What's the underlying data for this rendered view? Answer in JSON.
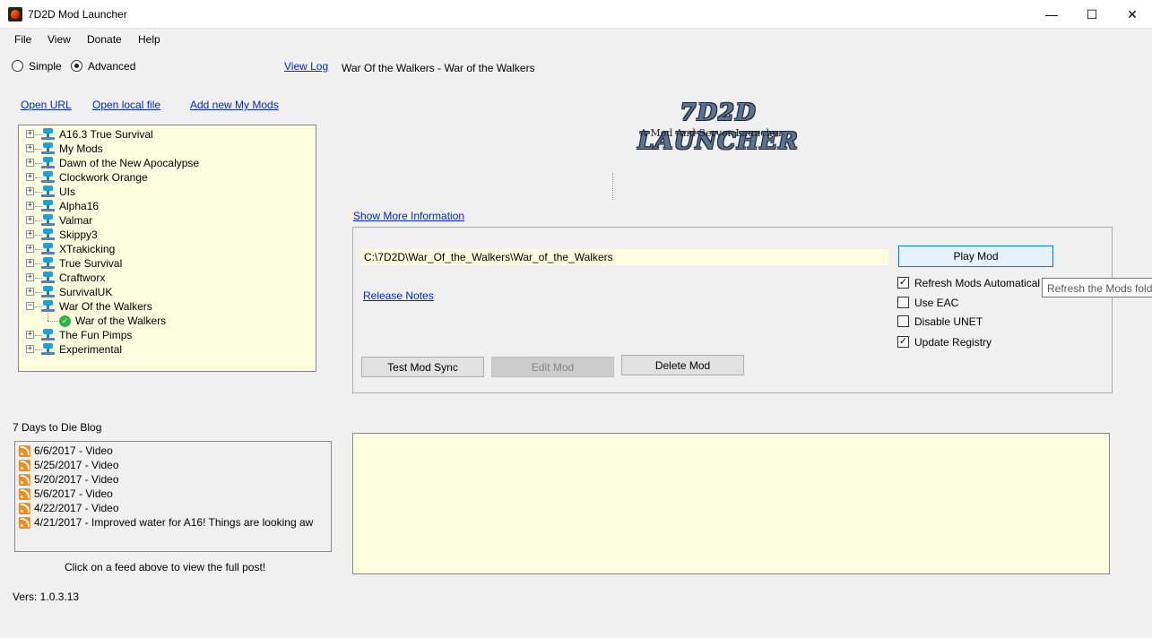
{
  "window": {
    "title": "7D2D Mod Launcher",
    "minimize": "—",
    "maximize": "☐",
    "close": "✕"
  },
  "menu": [
    "File",
    "View",
    "Donate",
    "Help"
  ],
  "mode": {
    "simple": "Simple",
    "advanced": "Advanced",
    "selected": "Advanced"
  },
  "view_log": "View Log",
  "current_mod_title": "War Of the Walkers - War of the Walkers",
  "links": {
    "open_url": "Open URL",
    "open_local_file": "Open local file",
    "add_new_my_mods": "Add new My Mods"
  },
  "tree": {
    "items": [
      {
        "label": "A16.3 True Survival",
        "expanded": false
      },
      {
        "label": "My Mods",
        "expanded": false
      },
      {
        "label": "Dawn of the New Apocalypse",
        "expanded": false
      },
      {
        "label": "Clockwork Orange",
        "expanded": false
      },
      {
        "label": "UIs",
        "expanded": false
      },
      {
        "label": "Alpha16",
        "expanded": false
      },
      {
        "label": "Valmar",
        "expanded": false
      },
      {
        "label": "Skippy3",
        "expanded": false
      },
      {
        "label": "XTrakicking",
        "expanded": false
      },
      {
        "label": "True Survival",
        "expanded": false
      },
      {
        "label": "Craftworx",
        "expanded": false
      },
      {
        "label": "SurvivalUK",
        "expanded": false
      },
      {
        "label": "War Of the Walkers",
        "expanded": true,
        "child": "War of the Walkers"
      },
      {
        "label": "The Fun Pimps",
        "expanded": false
      },
      {
        "label": "Experimental",
        "expanded": false
      }
    ]
  },
  "logo": {
    "title": "7D2D LAUNCHER",
    "subtitle": "A Mod And Server Launcher"
  },
  "show_more_info": "Show More Information",
  "mod_panel": {
    "path": "C:\\7D2D\\War_Of_the_Walkers\\War_of_the_Walkers",
    "play_mod": "Play Mod",
    "release_notes": "Release Notes",
    "test_mod_sync": "Test Mod Sync",
    "edit_mod": "Edit Mod",
    "delete_mod": "Delete Mod",
    "options": [
      {
        "label": "Refresh Mods Automatical",
        "checked": true
      },
      {
        "label": "Use EAC",
        "checked": false
      },
      {
        "label": "Disable UNET",
        "checked": false
      },
      {
        "label": "Update Registry",
        "checked": true
      }
    ],
    "tooltip": "Refresh the Mods fold"
  },
  "blog": {
    "heading": "7 Days to Die Blog",
    "items": [
      "6/6/2017 - Video",
      "5/25/2017 - Video",
      "5/20/2017 - Video",
      "5/6/2017 - Video",
      "4/22/2017 - Video",
      "4/21/2017 - Improved water for A16!  Things are looking aw"
    ],
    "hint": "Click on a feed above to view the full post!"
  },
  "version": "Vers: 1.0.3.13"
}
